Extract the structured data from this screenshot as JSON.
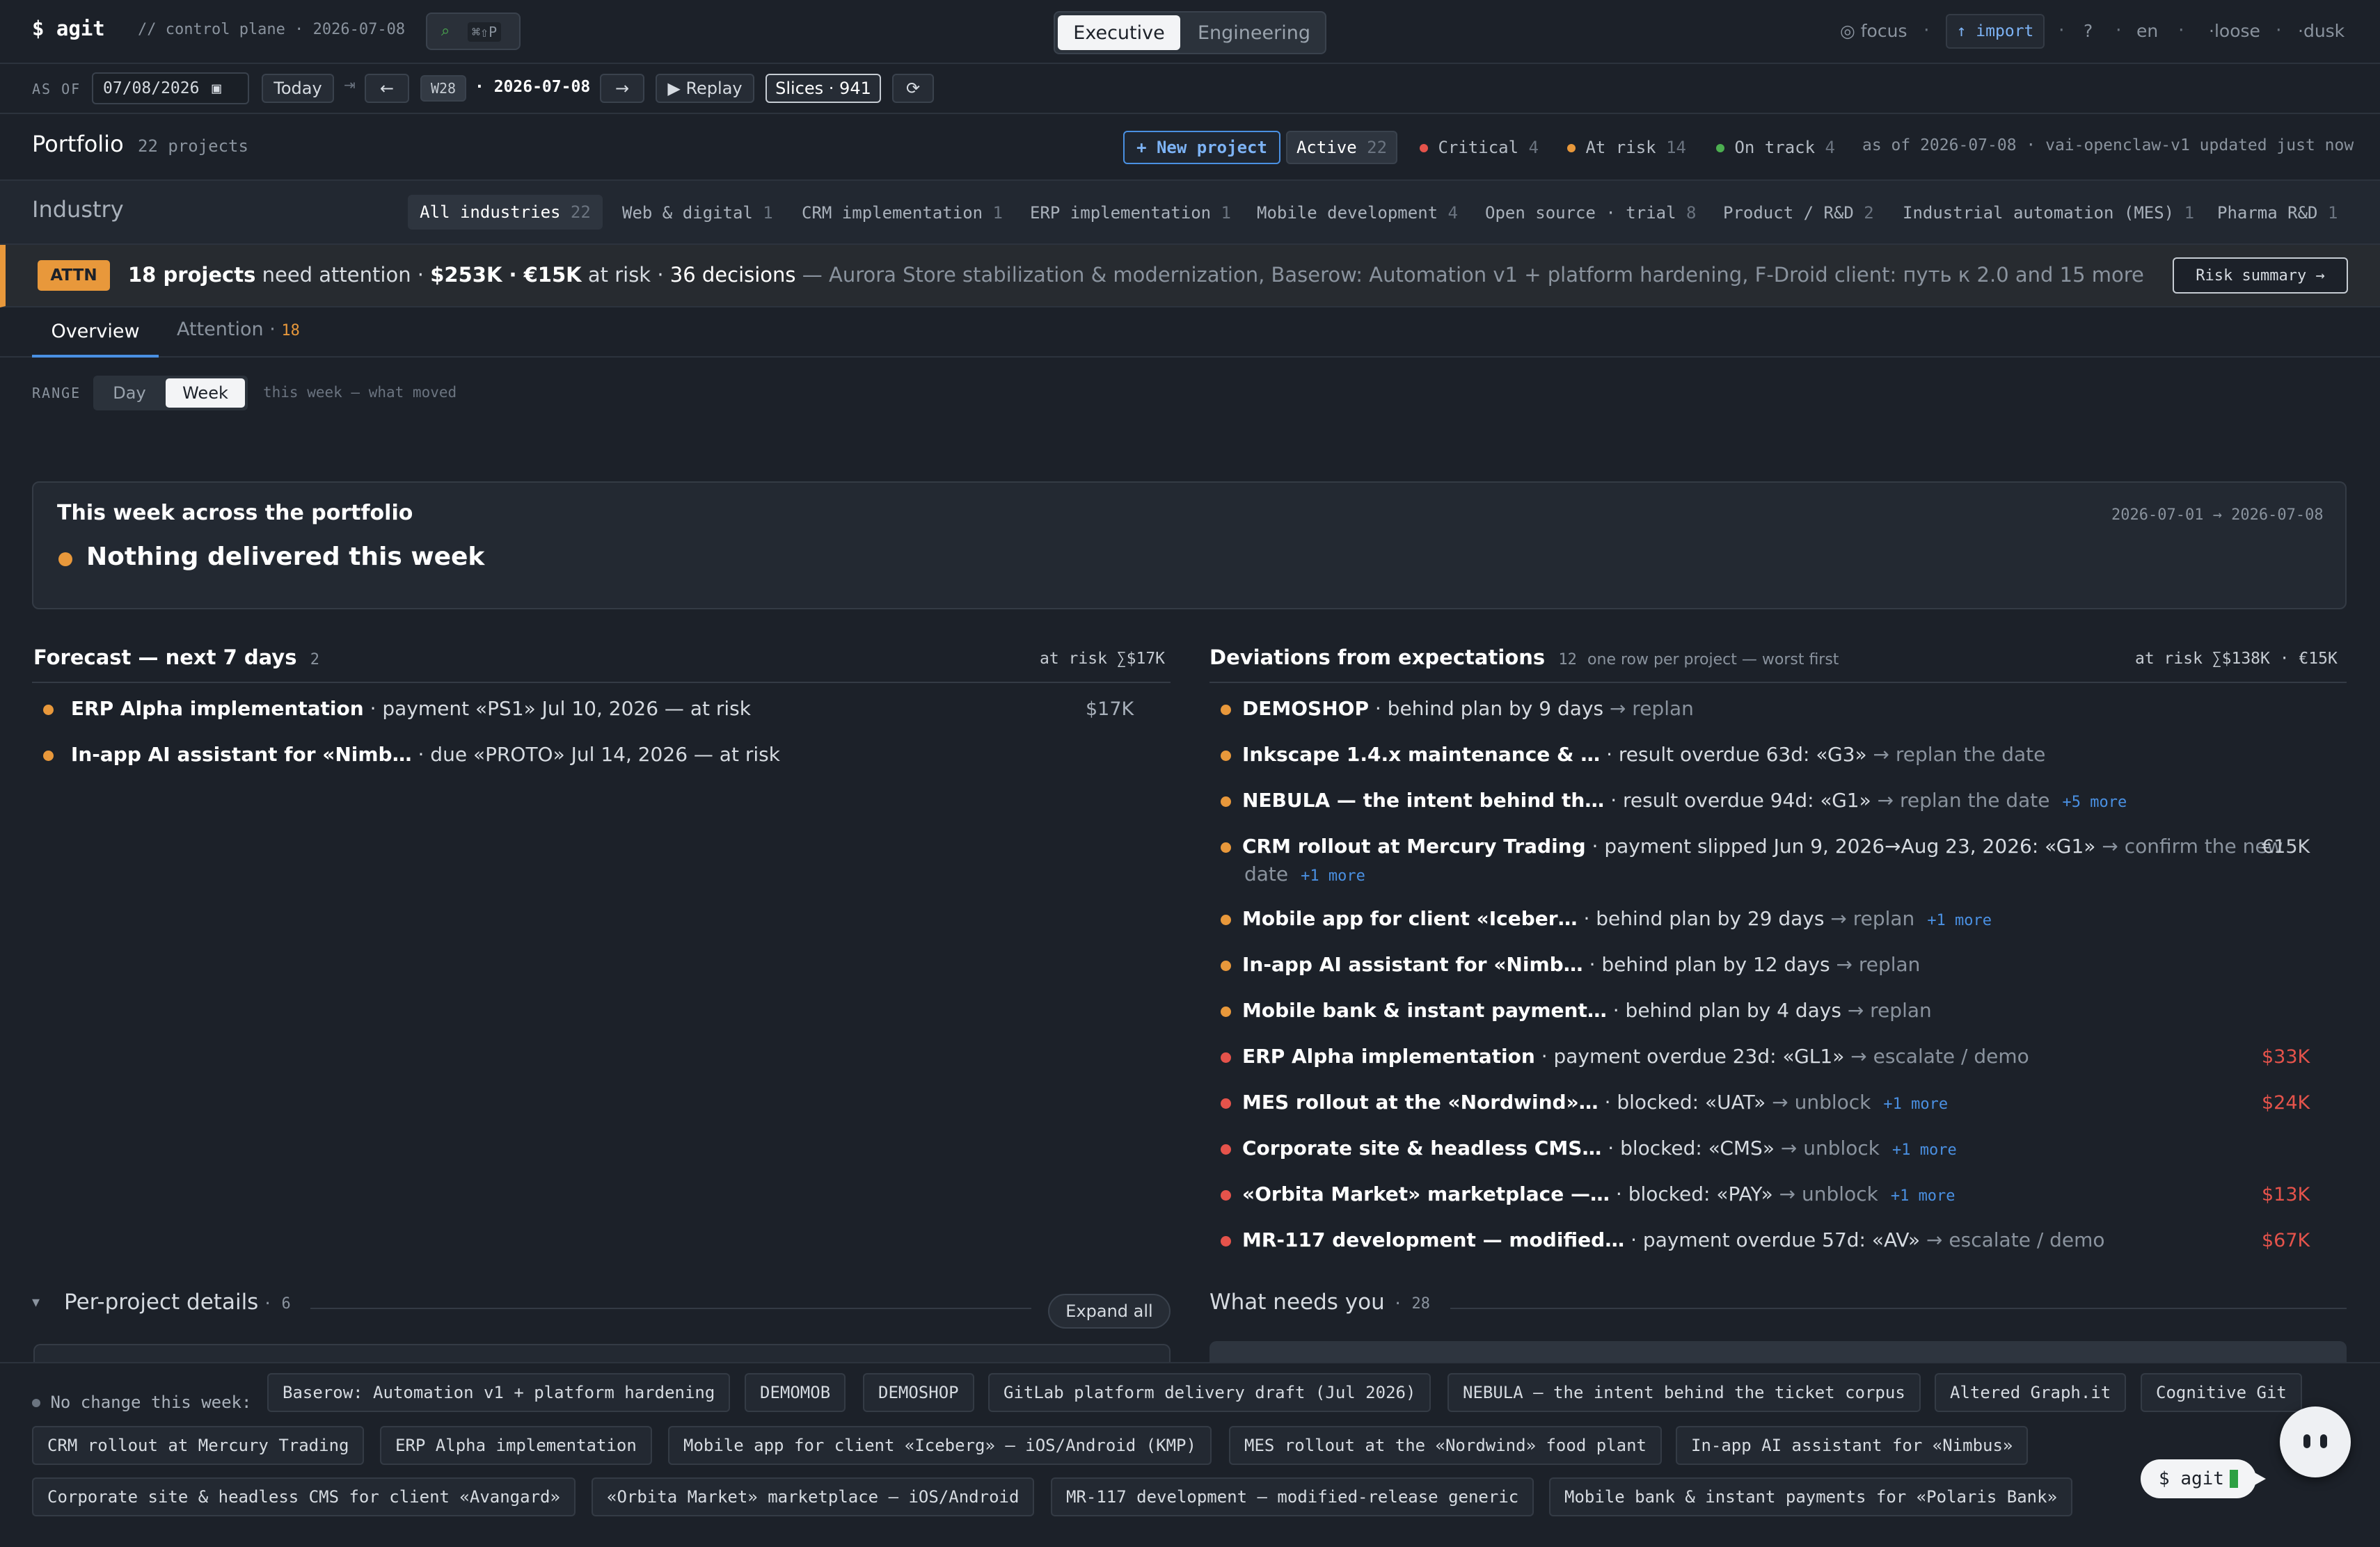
{
  "app": {
    "brand": "$ agit",
    "subtitle": "// control plane · 2026-07-08",
    "shortcut": "⌘⇧P"
  },
  "modes": [
    "Executive",
    "Engineering"
  ],
  "top_right": {
    "focus": "◎ focus",
    "import": "↑ import",
    "help": "?",
    "lang": "en",
    "loose": "·loose",
    "dusk": "·dusk"
  },
  "asof_bar": {
    "label": "AS OF",
    "date": "07/08/2026",
    "today": "Today",
    "arrow": "⇥",
    "prev": "←",
    "week": "W28",
    "current": "· 2026-07-08",
    "next": "→",
    "replay": "▶ Replay",
    "slices": "Slices · 941",
    "refresh": "⟳"
  },
  "portfolio": {
    "title": "Portfolio",
    "count": "22 projects",
    "new_project": "+ New project",
    "filters": [
      {
        "label": "Active",
        "count": "22"
      },
      {
        "label": "Critical",
        "count": "4"
      },
      {
        "label": "At risk",
        "count": "14"
      },
      {
        "label": "On track",
        "count": "4"
      }
    ],
    "status": "as of 2026-07-08 · vai-openclaw-v1 updated just now"
  },
  "industry": {
    "title": "Industry",
    "items": [
      {
        "label": "All industries",
        "count": "22"
      },
      {
        "label": "Web & digital",
        "count": "1"
      },
      {
        "label": "CRM implementation",
        "count": "1"
      },
      {
        "label": "ERP implementation",
        "count": "1"
      },
      {
        "label": "Mobile development",
        "count": "4"
      },
      {
        "label": "Open source · trial",
        "count": "8"
      },
      {
        "label": "Product / R&D",
        "count": "2"
      },
      {
        "label": "Industrial automation (MES)",
        "count": "1"
      },
      {
        "label": "Pharma R&D",
        "count": "1"
      }
    ]
  },
  "attention": {
    "badge": "ATTN",
    "count": "18 projects",
    "need": "need attention ·",
    "money": "$253K · €15K",
    "at_risk": "at risk ·",
    "decisions": "36 decisions",
    "rest": "— Aurora Store stabilization & modernization, Baserow: Automation v1 + platform hardening, F-Droid client: путь к 2.0 and 15 more",
    "button": "Risk summary →"
  },
  "tabs": {
    "overview": "Overview",
    "attention": "Attention ·",
    "attention_count": "18"
  },
  "range": {
    "label": "RANGE",
    "day": "Day",
    "week": "Week",
    "note": "this week — what moved"
  },
  "week_card": {
    "title": "This week across the portfolio",
    "headline": "Nothing delivered this week",
    "dates": "2026-07-01 → 2026-07-08"
  },
  "forecast": {
    "title": "Forecast — next 7 days",
    "count": "2",
    "risk": "at risk ∑$17K",
    "rows": [
      {
        "name": "ERP Alpha implementation",
        "detail": "· payment «PS1» Jul 10, 2026 — at risk",
        "amount": "$17K"
      },
      {
        "name": "In-app AI assistant for «Nimb…",
        "detail": "· due «PROTO» Jul 14, 2026 — at risk",
        "amount": ""
      }
    ]
  },
  "deviations": {
    "title": "Deviations from expectations",
    "count": "12",
    "note": "one row per project — worst first",
    "risk": "at risk ∑$138K · €15K",
    "rows": [
      {
        "name": "DEMOSHOP",
        "detail": "· behind plan by 9 days",
        "action": "→ replan",
        "more": "",
        "amount": "",
        "color": "#e8983b"
      },
      {
        "name": "Inkscape 1.4.x maintenance & …",
        "detail": "· result overdue 63d: «G3»",
        "action": "→ replan the date",
        "more": "",
        "amount": "",
        "color": "#e8983b"
      },
      {
        "name": "NEBULA — the intent behind th…",
        "detail": "· result overdue 94d: «G1»",
        "action": "→ replan the date",
        "more": "+5 more",
        "amount": "",
        "color": "#e8983b"
      },
      {
        "name": "CRM rollout at Mercury Trading",
        "detail": "· payment slipped Jun 9, 2026→Aug 23, 2026: «G1»",
        "action": "→ confirm the new",
        "action2": "date",
        "more": "+1 more",
        "amount": "€15K",
        "color": "#e8983b"
      },
      {
        "name": "Mobile app for client «Iceber…",
        "detail": "· behind plan by 29 days",
        "action": "→ replan",
        "more": "+1 more",
        "amount": "",
        "color": "#e8983b"
      },
      {
        "name": "In-app AI assistant for «Nimb…",
        "detail": "· behind plan by 12 days",
        "action": "→ replan",
        "more": "",
        "amount": "",
        "color": "#e8983b"
      },
      {
        "name": "Mobile bank & instant payment…",
        "detail": "· behind plan by 4 days",
        "action": "→ replan",
        "more": "",
        "amount": "",
        "color": "#e8983b"
      },
      {
        "name": "ERP Alpha implementation",
        "detail": "· payment overdue 23d: «GL1»",
        "action": "→ escalate / demo",
        "more": "",
        "amount": "$33K",
        "color": "#e5534b"
      },
      {
        "name": "MES rollout at the «Nordwind»…",
        "detail": "· blocked: «UAT»",
        "action": "→ unblock",
        "more": "+1 more",
        "amount": "$24K",
        "color": "#e5534b"
      },
      {
        "name": "Corporate site & headless CMS…",
        "detail": "· blocked: «CMS»",
        "action": "→ unblock",
        "more": "+1 more",
        "amount": "",
        "color": "#e5534b"
      },
      {
        "name": "«Orbita Market» marketplace —…",
        "detail": "· blocked: «PAY»",
        "action": "→ unblock",
        "more": "+1 more",
        "amount": "$13K",
        "color": "#e5534b"
      },
      {
        "name": "MR-117 development — modified…",
        "detail": "· payment overdue 57d: «AV»",
        "action": "→ escalate / demo",
        "more": "",
        "amount": "$67K",
        "color": "#e5534b"
      }
    ]
  },
  "per_project": {
    "title": "Per-project details",
    "count": "6",
    "expand": "Expand all",
    "toggle": "▾"
  },
  "needs_you": {
    "title": "What needs you",
    "count": "28"
  },
  "no_change": {
    "label": "No change this week:",
    "chips": [
      "Baserow: Automation v1 + platform hardening",
      "DEMOMOB",
      "DEMOSHOP",
      "GitLab platform delivery draft (Jul 2026)",
      "NEBULA — the intent behind the ticket corpus",
      "Altered Graph.it",
      "Cognitive Git",
      "CRM rollout at Mercury Trading",
      "ERP Alpha implementation",
      "Mobile app for client «Iceberg» — iOS/Android (KMP)",
      "MES rollout at the «Nordwind» food plant",
      "In-app AI assistant for «Nimbus»",
      "Corporate site & headless CMS for client «Avangard»",
      "«Orbita Market» marketplace — iOS/Android",
      "MR-117 development — modified-release generic",
      "Mobile bank & instant payments for «Polaris Bank»"
    ]
  },
  "assistant": {
    "label": "$ agit"
  },
  "colors": {
    "accent": "#4a90e2",
    "attention": "#e8983b",
    "critical": "#e5534b",
    "ok": "#4caf50"
  }
}
